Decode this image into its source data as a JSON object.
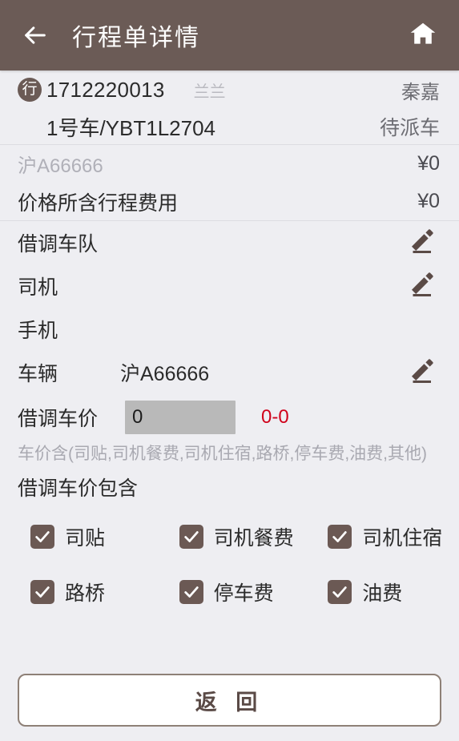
{
  "header": {
    "title": "行程单详情",
    "back_icon": "arrow-left-icon",
    "home_icon": "home-icon"
  },
  "summary": {
    "badge": "行",
    "order_no": "1712220013",
    "operator": "兰兰",
    "customer": "秦嘉",
    "vehicle_line": "1号车/YBT1L2704",
    "status": "待派车"
  },
  "prices": [
    {
      "label": "沪A66666",
      "value": "¥0",
      "muted": true
    },
    {
      "label": "价格所含行程费用",
      "value": "¥0",
      "muted": false
    }
  ],
  "fields": [
    {
      "label": "借调车队",
      "value": "",
      "edit_icon": "pencil-icon",
      "editable": true
    },
    {
      "label": "司机",
      "value": "",
      "edit_icon": "pencil-icon",
      "editable": true
    },
    {
      "label": "手机",
      "value": "",
      "edit_icon": "",
      "editable": false
    },
    {
      "label": "车辆",
      "value": "沪A66666",
      "edit_icon": "pencil-icon",
      "editable": true
    }
  ],
  "price_input": {
    "label": "借调车价",
    "value": "0",
    "placeholder": "0",
    "range": "0-0",
    "range_color": "#d0021b"
  },
  "hint": "车价含(司贴,司机餐费,司机住宿,路桥,停车费,油费,其他)",
  "checkbox_group": {
    "title": "借调车价包含",
    "items": [
      {
        "label": "司贴",
        "checked": true
      },
      {
        "label": "司机餐费",
        "checked": true
      },
      {
        "label": "司机住宿",
        "checked": true
      },
      {
        "label": "路桥",
        "checked": true
      },
      {
        "label": "停车费",
        "checked": true
      },
      {
        "label": "油费",
        "checked": true
      }
    ]
  },
  "footer": {
    "back_label": "返 回"
  },
  "colors": {
    "header_bg": "#6b5b56",
    "page_bg": "#eeeef2",
    "accent": "#6b5954",
    "danger": "#d0021b",
    "input_bg": "#b9b9b9"
  }
}
